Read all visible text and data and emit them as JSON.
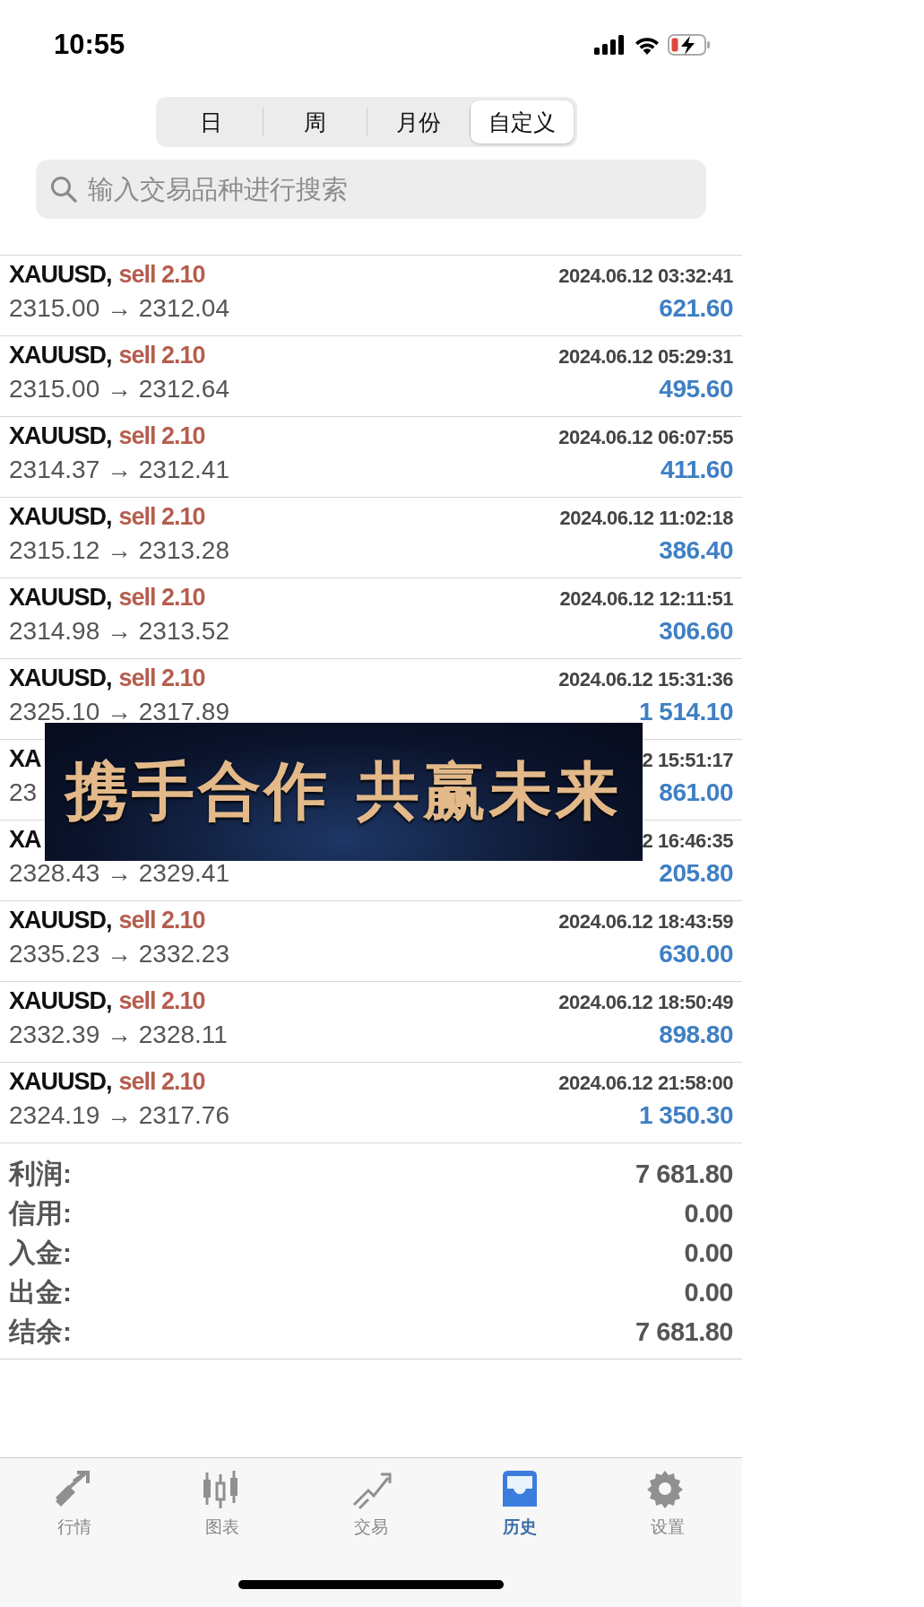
{
  "status_bar": {
    "time": "10:55"
  },
  "periods": [
    {
      "label": "日",
      "selected": false
    },
    {
      "label": "周",
      "selected": false
    },
    {
      "label": "月份",
      "selected": false
    },
    {
      "label": "自定义",
      "selected": true
    }
  ],
  "search": {
    "placeholder": "输入交易品种进行搜索"
  },
  "deals": [
    {
      "symbol": "XAUUSD,",
      "order": "sell 2.10",
      "time": "2024.06.12 03:32:41",
      "prices": "2315.00 → 2312.04",
      "profit": "621.60"
    },
    {
      "symbol": "XAUUSD,",
      "order": "sell 2.10",
      "time": "2024.06.12 05:29:31",
      "prices": "2315.00 → 2312.64",
      "profit": "495.60"
    },
    {
      "symbol": "XAUUSD,",
      "order": "sell 2.10",
      "time": "2024.06.12 06:07:55",
      "prices": "2314.37 → 2312.41",
      "profit": "411.60"
    },
    {
      "symbol": "XAUUSD,",
      "order": "sell 2.10",
      "time": "2024.06.12 11:02:18",
      "prices": "2315.12 → 2313.28",
      "profit": "386.40"
    },
    {
      "symbol": "XAUUSD,",
      "order": "sell 2.10",
      "time": "2024.06.12 12:11:51",
      "prices": "2314.98 → 2313.52",
      "profit": "306.60"
    },
    {
      "symbol": "XAUUSD,",
      "order": "sell 2.10",
      "time": "2024.06.12 15:31:36",
      "prices": "2325.10 → 2317.89",
      "profit": "1 514.10"
    },
    {
      "symbol": "XA",
      "time": "2 15:51:17",
      "prices": "23",
      "profit": "861.00"
    },
    {
      "symbol": "XA",
      "time": "2 16:46:35",
      "prices": "2328.43 → 2329.41",
      "profit": "205.80"
    },
    {
      "symbol": "XAUUSD,",
      "order": "sell 2.10",
      "time": "2024.06.12 18:43:59",
      "prices": "2335.23 → 2332.23",
      "profit": "630.00"
    },
    {
      "symbol": "XAUUSD,",
      "order": "sell 2.10",
      "time": "2024.06.12 18:50:49",
      "prices": "2332.39 → 2328.11",
      "profit": "898.80"
    },
    {
      "symbol": "XAUUSD,",
      "order": "sell 2.10",
      "time": "2024.06.12 21:58:00",
      "prices": "2324.19 → 2317.76",
      "profit": "1 350.30"
    }
  ],
  "banner": {
    "text": "携手合作 共赢未来"
  },
  "summary": [
    {
      "label": "利润:",
      "value": "7 681.80"
    },
    {
      "label": "信用:",
      "value": "0.00"
    },
    {
      "label": "入金:",
      "value": "0.00"
    },
    {
      "label": "出金:",
      "value": "0.00"
    },
    {
      "label": "结余:",
      "value": "7 681.80"
    }
  ],
  "tab_bar": [
    {
      "kind": "quotes",
      "label": "行情",
      "selected": false
    },
    {
      "kind": "chart",
      "label": "图表",
      "selected": false
    },
    {
      "kind": "trade",
      "label": "交易",
      "selected": false
    },
    {
      "kind": "history",
      "label": "历史",
      "selected": true
    },
    {
      "kind": "settings",
      "label": "设置",
      "selected": false
    }
  ]
}
